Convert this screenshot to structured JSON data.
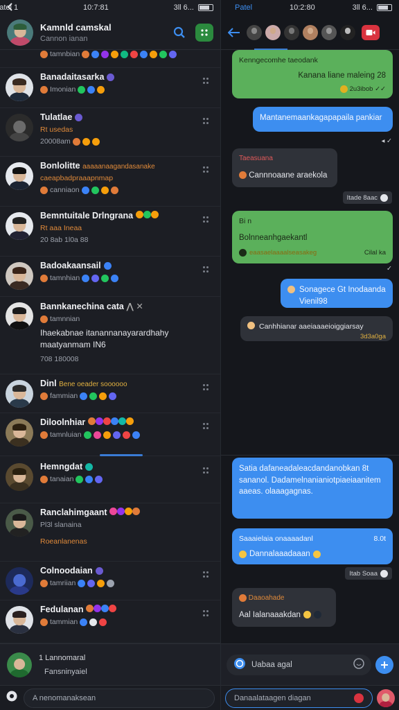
{
  "status_left": {
    "carrier": "Patel 1",
    "time": "10:7:81",
    "signal": "3ll 6..."
  },
  "status_right": {
    "carrier": "Patel",
    "time": "10:2:80",
    "signal": "3ll 6..."
  },
  "left_header": {
    "title": "Kamnld camskal",
    "subtitle": "Cannon ianan"
  },
  "chats": [
    {
      "name": "",
      "line": "tamnbian",
      "dots": [
        "#e07b39",
        "#3b82f6",
        "#9333ea",
        "#f59e0b",
        "#10b981",
        "#ef4444",
        "#3b82f6",
        "#f59e0b",
        "#22c55e",
        "#6366f1",
        "#ec4899",
        "#14b8a6"
      ]
    },
    {
      "name": "Banadaitasarka",
      "line": "Imonian",
      "dots": [
        "#22c55e",
        "#3b82f6",
        "#f59e0b"
      ]
    },
    {
      "name": "Tulatlae",
      "line": "Rt usedas",
      "line2": "20008am",
      "dots": [
        "#e07b39",
        "#f59e0b",
        "#f59e0b"
      ]
    },
    {
      "name": "Bonlolitte",
      "name_suffix": "aaaaanaagandasanake",
      "line": "caeapbadpraaapnmap",
      "line2": "canniaon",
      "dots": [
        "#3b82f6",
        "#22c55e",
        "#f59e0b",
        "#e07b39"
      ]
    },
    {
      "name": "Bemntuitale Drlngrana",
      "line": "Rt aaa Ineaa",
      "line2": "20 8ab 1l0a 88",
      "dots": [
        "#f59e0b",
        "#22c55e",
        "#f59e0b"
      ]
    },
    {
      "name": "Badoakaansail",
      "line": "tamnhian",
      "dots": [
        "#3b82f6",
        "#6366f1",
        "#22c55e",
        "#3b82f6"
      ]
    },
    {
      "name": "Bannkanechina cata",
      "line": "tamnnian",
      "para": "Ihaekabnae itanannanayarardhahy maatyanmam IN6",
      "line2": "708 180008",
      "dots": []
    },
    {
      "name": "Dinl",
      "name_suffix": "Bene oeader soooooo",
      "line": "fammian",
      "dots": [
        "#3b82f6",
        "#22c55e",
        "#f59e0b",
        "#6366f1"
      ]
    },
    {
      "name": "Diloolnhiar",
      "line": "tamnluian",
      "dots": [
        "#e07b39",
        "#22c55e",
        "#ec4899",
        "#f59e0b",
        "#6366f1",
        "#ef4444",
        "#3b82f6",
        "#14b8a6",
        "#f59e0b",
        "#9333ea",
        "#ef4444"
      ]
    },
    {
      "name": "Hemngdat",
      "line": "tanaian",
      "dots": [
        "#22c55e",
        "#3b82f6",
        "#6366f1"
      ]
    },
    {
      "name": "Ranclahimgaant",
      "line": "Pl3l slanaina",
      "line2": "Roeanlanenas",
      "dots": [
        "#ec4899",
        "#9333ea",
        "#f59e0b",
        "#e07b39"
      ]
    },
    {
      "name": "Colnoodaian",
      "line": "tamriian",
      "dots": [
        "#3b82f6",
        "#6366f1",
        "#f59e0b",
        "#9ca3af"
      ]
    },
    {
      "name": "Fedulanan",
      "line": "tammian",
      "dots": [
        "#3b82f6",
        "#e5e7eb",
        "#ef4444"
      ]
    }
  ],
  "left_footer": {
    "line1": "1 Lannomaral",
    "line2": "Fansninyaiel"
  },
  "left_bottom": {
    "input_placeholder": "A  nenomanaksean"
  },
  "right_messages": [
    {
      "kind": "green",
      "title": "Kenngecomhe taeodank",
      "body": "Kanana liane maleing 28",
      "meta": "2u3ibob"
    },
    {
      "kind": "blue",
      "body": "Mantanemaankagapapaila pankiar"
    },
    {
      "kind": "dark",
      "title": "Taeasuana",
      "body": "Cannnoaane araekola",
      "meta": "Itade 8aac"
    },
    {
      "kind": "green",
      "title": "Bi n",
      "body": "Bolnneanhgaekantl",
      "sub": "eaasaelaaaalseasakeg",
      "meta": "Cilal ka"
    },
    {
      "kind": "blue",
      "body": "Sonagece Gt Inodaanda Vienil98"
    },
    {
      "kind": "dark",
      "body": "Canhhianar aaeiaaaeioiggiarsay",
      "meta": "3d3a0ga"
    },
    {
      "kind": "blue",
      "body": "Satia dafaneadaleacdandanobkan 8t sananol. Dadamelnanianiotpiaeiaanitem aaeas. olaaagagnas."
    },
    {
      "kind": "blue",
      "title": "Saaaielaia onaaaadanl",
      "body": "Dannalaaadaaan",
      "meta": "8.0t"
    },
    {
      "kind": "meta",
      "meta": "Itab Soaa"
    },
    {
      "kind": "dark",
      "title": "Daaoahade",
      "body": "Aal Ialanaaakdan"
    }
  ],
  "right_compose": {
    "placeholder": "Uabaa agal"
  },
  "right_bottom": {
    "placeholder": "Danaalataagen diagan"
  }
}
